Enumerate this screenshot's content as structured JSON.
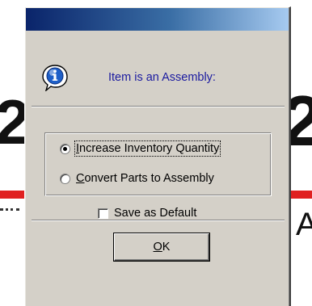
{
  "dialog": {
    "title": "",
    "message": "Item is an Assembly:",
    "options": [
      {
        "prefix": "",
        "accel": "I",
        "rest": "ncrease Inventory Quantity",
        "checked": true
      },
      {
        "prefix": "",
        "accel": "C",
        "rest": "onvert Parts to Assembly",
        "checked": false
      }
    ],
    "save_default": {
      "label": "Save as Default",
      "checked": false
    },
    "ok": {
      "accel": "O",
      "rest": "K"
    }
  },
  "icons": {
    "message_icon": "info-icon",
    "accent": "#1a1aa0",
    "titlebar_start": "#0a246a",
    "titlebar_end": "#a6caf0"
  }
}
